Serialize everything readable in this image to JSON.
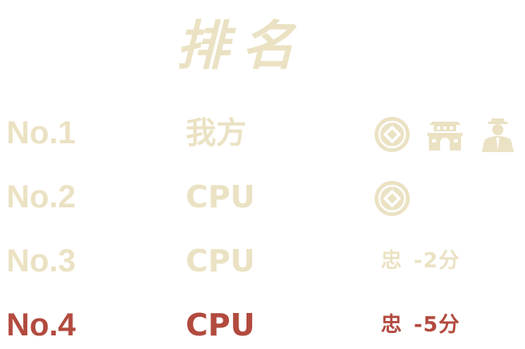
{
  "screen": {
    "title": "排名"
  },
  "colors": {
    "pale": "#ebe2c4",
    "highlight": "#b24a3e"
  },
  "rows": [
    {
      "rank": "No.1",
      "player": "我方",
      "badges": [
        "coin-icon",
        "fortress-icon",
        "official-icon"
      ],
      "note_role": "",
      "note_score": ""
    },
    {
      "rank": "No.2",
      "player": "CPU",
      "badges": [
        "coin-icon"
      ],
      "note_role": "",
      "note_score": ""
    },
    {
      "rank": "No.3",
      "player": "CPU",
      "badges": [],
      "note_role": "忠",
      "note_score": "-2分"
    },
    {
      "rank": "No.4",
      "player": "CPU",
      "badges": [],
      "note_role": "忠",
      "note_score": "-5分"
    }
  ]
}
